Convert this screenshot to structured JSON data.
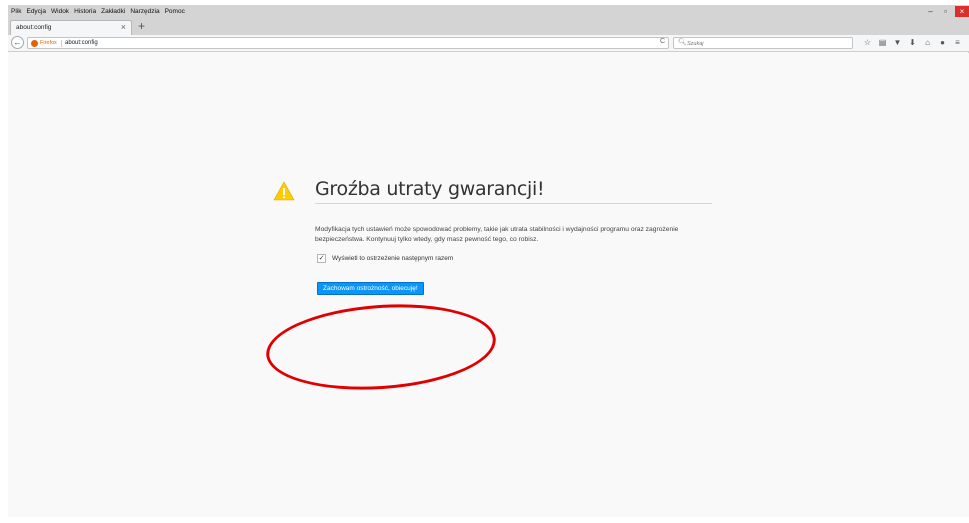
{
  "menubar": {
    "items": [
      "Plik",
      "Edycja",
      "Widok",
      "Historia",
      "Zakładki",
      "Narzędzia",
      "Pomoc"
    ]
  },
  "window_controls": {
    "minimize": "–",
    "maximize": "▫",
    "close": "×"
  },
  "tab": {
    "title": "about:config",
    "close": "×",
    "new_tab": "+"
  },
  "navbar": {
    "back": "←",
    "identity": "Firefox",
    "url": "about:config",
    "reload": "C",
    "search_placeholder": "Szukaj"
  },
  "toolbar_icons": [
    "star-icon",
    "library-icon",
    "pocket-icon",
    "download-icon",
    "home-icon",
    "account-icon",
    "menu-icon"
  ],
  "warning": {
    "title": "Groźba utraty gwarancji!",
    "description": "Modyfikacja tych ustawień może spowodować problemy, takie jak utrata stabilności i wydajności programu oraz zagrożenie bezpieczeństwa. Kontynuuj tylko wtedy, gdy masz pewność tego, co robisz.",
    "checkbox_label": "Wyświetl to ostrzeżenie następnym razem",
    "checkbox_checked": true,
    "button_label": "Zachowam ostrożność, obiecuję!"
  },
  "colors": {
    "accent": "#0996f8",
    "warning_icon": "#ffcc00",
    "annotation": "#e00000"
  }
}
